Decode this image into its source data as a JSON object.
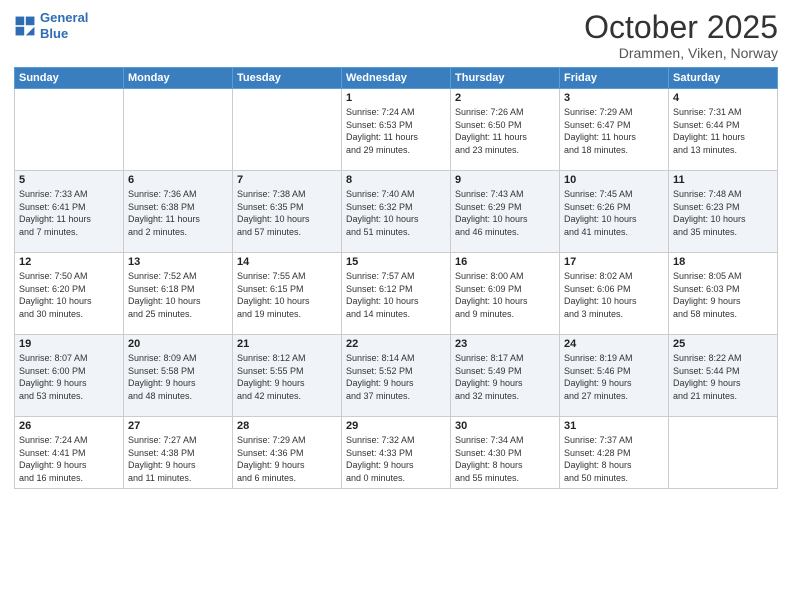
{
  "header": {
    "logo_line1": "General",
    "logo_line2": "Blue",
    "month": "October 2025",
    "location": "Drammen, Viken, Norway"
  },
  "weekdays": [
    "Sunday",
    "Monday",
    "Tuesday",
    "Wednesday",
    "Thursday",
    "Friday",
    "Saturday"
  ],
  "weeks": [
    [
      {
        "day": "",
        "info": ""
      },
      {
        "day": "",
        "info": ""
      },
      {
        "day": "",
        "info": ""
      },
      {
        "day": "1",
        "info": "Sunrise: 7:24 AM\nSunset: 6:53 PM\nDaylight: 11 hours\nand 29 minutes."
      },
      {
        "day": "2",
        "info": "Sunrise: 7:26 AM\nSunset: 6:50 PM\nDaylight: 11 hours\nand 23 minutes."
      },
      {
        "day": "3",
        "info": "Sunrise: 7:29 AM\nSunset: 6:47 PM\nDaylight: 11 hours\nand 18 minutes."
      },
      {
        "day": "4",
        "info": "Sunrise: 7:31 AM\nSunset: 6:44 PM\nDaylight: 11 hours\nand 13 minutes."
      }
    ],
    [
      {
        "day": "5",
        "info": "Sunrise: 7:33 AM\nSunset: 6:41 PM\nDaylight: 11 hours\nand 7 minutes."
      },
      {
        "day": "6",
        "info": "Sunrise: 7:36 AM\nSunset: 6:38 PM\nDaylight: 11 hours\nand 2 minutes."
      },
      {
        "day": "7",
        "info": "Sunrise: 7:38 AM\nSunset: 6:35 PM\nDaylight: 10 hours\nand 57 minutes."
      },
      {
        "day": "8",
        "info": "Sunrise: 7:40 AM\nSunset: 6:32 PM\nDaylight: 10 hours\nand 51 minutes."
      },
      {
        "day": "9",
        "info": "Sunrise: 7:43 AM\nSunset: 6:29 PM\nDaylight: 10 hours\nand 46 minutes."
      },
      {
        "day": "10",
        "info": "Sunrise: 7:45 AM\nSunset: 6:26 PM\nDaylight: 10 hours\nand 41 minutes."
      },
      {
        "day": "11",
        "info": "Sunrise: 7:48 AM\nSunset: 6:23 PM\nDaylight: 10 hours\nand 35 minutes."
      }
    ],
    [
      {
        "day": "12",
        "info": "Sunrise: 7:50 AM\nSunset: 6:20 PM\nDaylight: 10 hours\nand 30 minutes."
      },
      {
        "day": "13",
        "info": "Sunrise: 7:52 AM\nSunset: 6:18 PM\nDaylight: 10 hours\nand 25 minutes."
      },
      {
        "day": "14",
        "info": "Sunrise: 7:55 AM\nSunset: 6:15 PM\nDaylight: 10 hours\nand 19 minutes."
      },
      {
        "day": "15",
        "info": "Sunrise: 7:57 AM\nSunset: 6:12 PM\nDaylight: 10 hours\nand 14 minutes."
      },
      {
        "day": "16",
        "info": "Sunrise: 8:00 AM\nSunset: 6:09 PM\nDaylight: 10 hours\nand 9 minutes."
      },
      {
        "day": "17",
        "info": "Sunrise: 8:02 AM\nSunset: 6:06 PM\nDaylight: 10 hours\nand 3 minutes."
      },
      {
        "day": "18",
        "info": "Sunrise: 8:05 AM\nSunset: 6:03 PM\nDaylight: 9 hours\nand 58 minutes."
      }
    ],
    [
      {
        "day": "19",
        "info": "Sunrise: 8:07 AM\nSunset: 6:00 PM\nDaylight: 9 hours\nand 53 minutes."
      },
      {
        "day": "20",
        "info": "Sunrise: 8:09 AM\nSunset: 5:58 PM\nDaylight: 9 hours\nand 48 minutes."
      },
      {
        "day": "21",
        "info": "Sunrise: 8:12 AM\nSunset: 5:55 PM\nDaylight: 9 hours\nand 42 minutes."
      },
      {
        "day": "22",
        "info": "Sunrise: 8:14 AM\nSunset: 5:52 PM\nDaylight: 9 hours\nand 37 minutes."
      },
      {
        "day": "23",
        "info": "Sunrise: 8:17 AM\nSunset: 5:49 PM\nDaylight: 9 hours\nand 32 minutes."
      },
      {
        "day": "24",
        "info": "Sunrise: 8:19 AM\nSunset: 5:46 PM\nDaylight: 9 hours\nand 27 minutes."
      },
      {
        "day": "25",
        "info": "Sunrise: 8:22 AM\nSunset: 5:44 PM\nDaylight: 9 hours\nand 21 minutes."
      }
    ],
    [
      {
        "day": "26",
        "info": "Sunrise: 7:24 AM\nSunset: 4:41 PM\nDaylight: 9 hours\nand 16 minutes."
      },
      {
        "day": "27",
        "info": "Sunrise: 7:27 AM\nSunset: 4:38 PM\nDaylight: 9 hours\nand 11 minutes."
      },
      {
        "day": "28",
        "info": "Sunrise: 7:29 AM\nSunset: 4:36 PM\nDaylight: 9 hours\nand 6 minutes."
      },
      {
        "day": "29",
        "info": "Sunrise: 7:32 AM\nSunset: 4:33 PM\nDaylight: 9 hours\nand 0 minutes."
      },
      {
        "day": "30",
        "info": "Sunrise: 7:34 AM\nSunset: 4:30 PM\nDaylight: 8 hours\nand 55 minutes."
      },
      {
        "day": "31",
        "info": "Sunrise: 7:37 AM\nSunset: 4:28 PM\nDaylight: 8 hours\nand 50 minutes."
      },
      {
        "day": "",
        "info": ""
      }
    ]
  ]
}
